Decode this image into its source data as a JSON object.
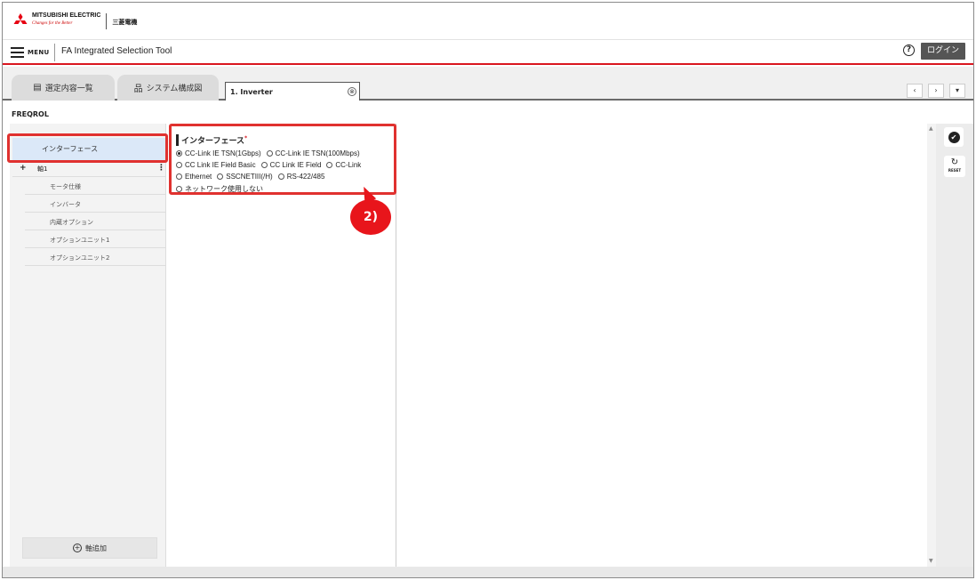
{
  "logo": {
    "english": "MITSUBISHI ELECTRIC",
    "slogan": "Changes for the Better",
    "japanese": "三菱電機"
  },
  "menu": {
    "label": "MENU",
    "app_title": "FA Integrated Selection Tool",
    "help_icon": "?",
    "login": "ログイン"
  },
  "tabs": [
    {
      "icon": "list-icon",
      "label": "選定内容一覧"
    },
    {
      "icon": "network-icon",
      "label": "システム構成図"
    }
  ],
  "active_tab": {
    "label": "1. Inverter",
    "close": "⊗"
  },
  "nav": {
    "prev": "‹",
    "next": "›",
    "menu": "▾"
  },
  "product": "FREQROL",
  "tree": {
    "interface": "インターフェース",
    "axis": {
      "expand": "+",
      "label": "軸1",
      "more": "⋮"
    },
    "items": [
      "モータ仕様",
      "インバータ",
      "内蔵オプション",
      "オプションユニット1",
      "オプションユニット2"
    ],
    "add_axis": "軸追加"
  },
  "interface_panel": {
    "title": "インターフェース",
    "required_mark": "*",
    "rows": [
      [
        {
          "label": "CC-Link IE TSN(1Gbps)",
          "checked": true
        },
        {
          "label": "CC-Link IE TSN(100Mbps)",
          "checked": false
        }
      ],
      [
        {
          "label": "CC Link IE Field Basic",
          "checked": false
        },
        {
          "label": "CC Link IE Field",
          "checked": false
        },
        {
          "label": "CC-Link",
          "checked": false
        }
      ],
      [
        {
          "label": "Ethernet",
          "checked": false
        },
        {
          "label": "SSCNETIII(/H)",
          "checked": false
        },
        {
          "label": "RS-422/485",
          "checked": false
        }
      ],
      [
        {
          "label": "ネットワーク使用しない",
          "checked": false
        }
      ]
    ]
  },
  "actions": {
    "confirm_icon": "check-icon",
    "reset_label": "RESET"
  },
  "annotation": {
    "badge": "2)",
    "color": "#e8151b"
  }
}
